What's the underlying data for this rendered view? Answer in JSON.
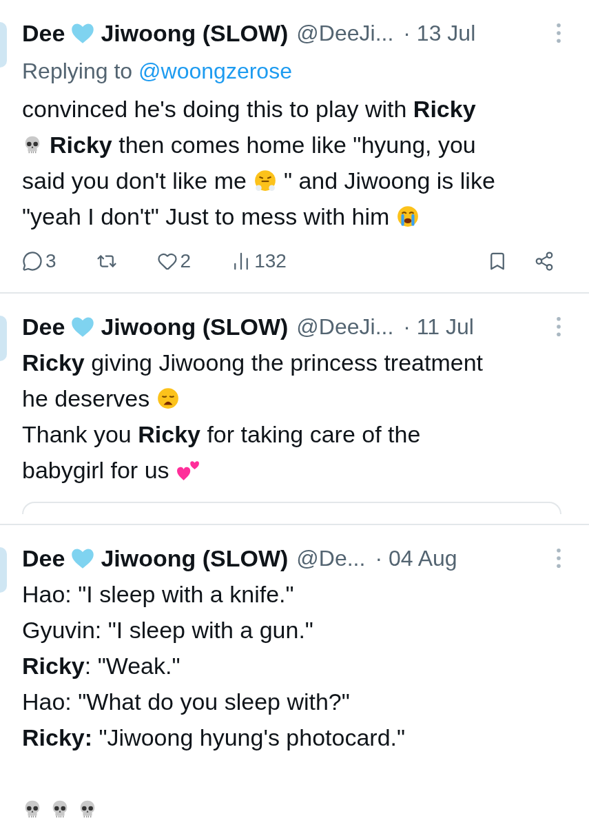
{
  "tweets": [
    {
      "author": {
        "first": "Dee",
        "rest": "Jiwoong (SLOW)"
      },
      "handle": "@DeeJi...",
      "date": "· 13 Jul",
      "reply_to": {
        "label": "Replying to",
        "handle": "@woongzerose"
      },
      "paragraphs": [
        [
          [
            {
              "kind": "text",
              "text": "convinced he's doing this to play with **Ricky**"
            }
          ],
          [
            {
              "kind": "skull"
            },
            {
              "kind": "text",
              "text": "**Ricky** then comes home like \"hyung, you"
            }
          ],
          [
            {
              "kind": "text",
              "text": "said you don't like me"
            },
            {
              "kind": "huff"
            },
            {
              "kind": "text",
              "text": "\" and Jiwoong is like"
            }
          ],
          [
            {
              "kind": "text",
              "text": "\"yeah I don't\" Just to mess with him"
            },
            {
              "kind": "sob"
            }
          ]
        ]
      ],
      "actions": [
        {
          "kind": "reply",
          "count": "3"
        },
        {
          "kind": "repost"
        },
        {
          "kind": "like",
          "count": "2"
        },
        {
          "kind": "views",
          "count": "132"
        },
        {
          "kind": "bookmark"
        },
        {
          "kind": "share"
        }
      ]
    },
    {
      "author": {
        "first": "Dee",
        "rest": "Jiwoong (SLOW)"
      },
      "handle": "@DeeJi...",
      "date": "· 11 Jul",
      "paragraphs": [
        [
          [
            {
              "kind": "text",
              "text": "**Ricky** giving Jiwoong the princess treatment"
            }
          ],
          [
            {
              "kind": "text",
              "text": "he deserves"
            },
            {
              "kind": "weary"
            }
          ],
          [
            {
              "kind": "text",
              "text": "Thank you **Ricky** for taking care of the"
            }
          ],
          [
            {
              "kind": "text",
              "text": "babygirl for us"
            },
            {
              "kind": "hearts"
            }
          ]
        ]
      ],
      "quote_card": true
    },
    {
      "author": {
        "first": "Dee",
        "rest": "Jiwoong (SLOW)"
      },
      "handle": "@De...",
      "date": "· 04 Aug",
      "paragraphs": [
        [
          [
            {
              "kind": "text",
              "text": "Hao: \"I sleep with a knife.\""
            }
          ],
          [
            {
              "kind": "text",
              "text": "Gyuvin: \"I sleep with a gun.\""
            }
          ],
          [
            {
              "kind": "text",
              "text": "**Ricky**: \"Weak.\""
            }
          ],
          [
            {
              "kind": "text",
              "text": "Hao: \"What do you sleep with?\""
            }
          ],
          [
            {
              "kind": "text",
              "text": "**Ricky:** \"Jiwoong hyung's photocard.\""
            }
          ]
        ],
        [
          [
            {
              "kind": "skull"
            },
            {
              "kind": "skull"
            },
            {
              "kind": "skull"
            }
          ]
        ]
      ]
    }
  ]
}
